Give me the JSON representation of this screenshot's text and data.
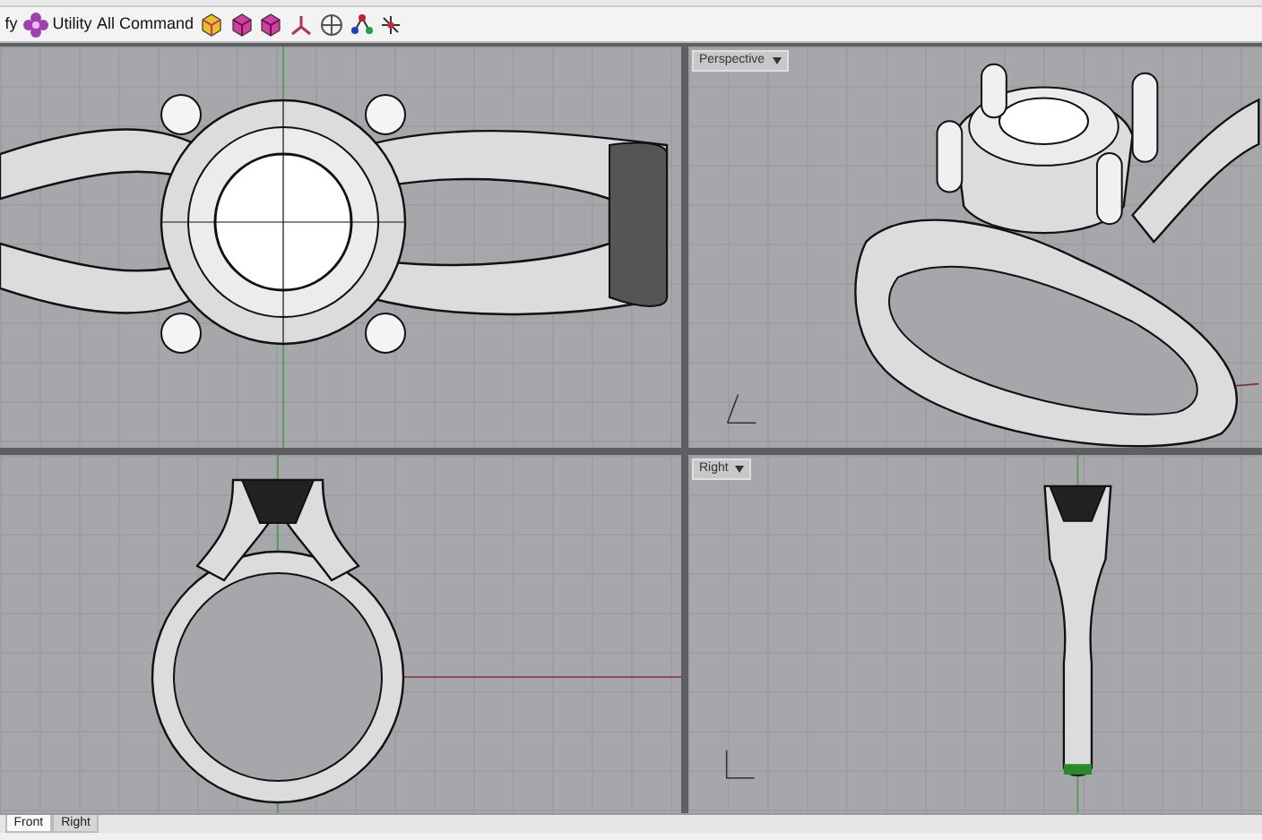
{
  "toolbar": {
    "items": [
      {
        "label": "fy",
        "icon": false
      },
      {
        "label": "Utility",
        "icon": true
      },
      {
        "label": "All Command",
        "icon": false
      }
    ]
  },
  "viewports": [
    {
      "kind": "top"
    },
    {
      "kind": "perspective",
      "label": "Perspective"
    },
    {
      "kind": "front"
    },
    {
      "kind": "right",
      "label": "Right"
    }
  ],
  "view_tabs": [
    {
      "label": "Front",
      "selected": true
    },
    {
      "label": "Right",
      "selected": false
    }
  ]
}
